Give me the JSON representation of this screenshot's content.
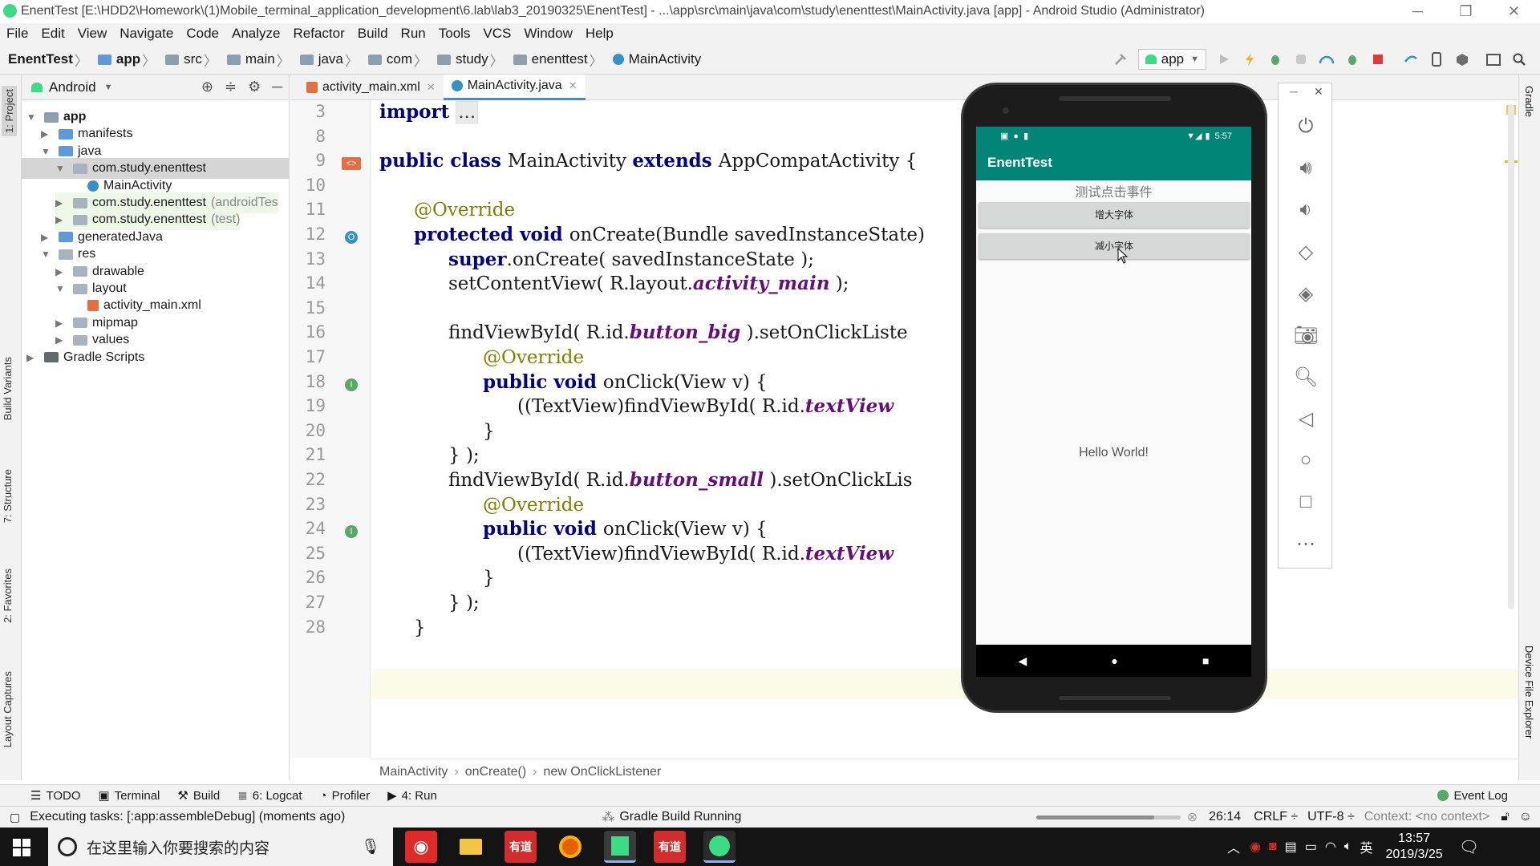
{
  "window": {
    "title": "EnentTest [E:\\HDD2\\Homework\\(1)Mobile_terminal_application_development\\6.lab\\lab3_20190325\\EnentTest] - ...\\app\\src\\main\\java\\com\\study\\enenttest\\MainActivity.java [app] - Android Studio (Administrator)"
  },
  "menu": [
    "File",
    "Edit",
    "View",
    "Navigate",
    "Code",
    "Analyze",
    "Refactor",
    "Build",
    "Run",
    "Tools",
    "VCS",
    "Window",
    "Help"
  ],
  "breadcrumb": [
    "EnentTest",
    "app",
    "src",
    "main",
    "java",
    "com",
    "study",
    "enenttest",
    "MainActivity"
  ],
  "run_config": "app",
  "left_tabs": [
    "1: Project",
    "Build Variants",
    "7: Structure",
    "2: Favorites",
    "Layout Captures"
  ],
  "right_tabs": [
    "Gradle",
    "Device File Explorer"
  ],
  "project": {
    "view": "Android",
    "tree": [
      {
        "label": "app",
        "indent": 0,
        "arrow": "▼",
        "bold": true
      },
      {
        "label": "manifests",
        "indent": 1,
        "arrow": "▶"
      },
      {
        "label": "java",
        "indent": 1,
        "arrow": "▼"
      },
      {
        "label": "com.study.enenttest",
        "indent": 2,
        "arrow": "▼",
        "selected": true
      },
      {
        "label": "MainActivity",
        "indent": 3,
        "arrow": ""
      },
      {
        "label": "com.study.enenttest",
        "suffix": "(androidTes",
        "indent": 2,
        "arrow": "▶",
        "hl": true
      },
      {
        "label": "com.study.enenttest",
        "suffix": "(test)",
        "indent": 2,
        "arrow": "▶",
        "hl": true
      },
      {
        "label": "generatedJava",
        "indent": 1,
        "arrow": "▶"
      },
      {
        "label": "res",
        "indent": 1,
        "arrow": "▼"
      },
      {
        "label": "drawable",
        "indent": 2,
        "arrow": "▶"
      },
      {
        "label": "layout",
        "indent": 2,
        "arrow": "▼"
      },
      {
        "label": "activity_main.xml",
        "indent": 3,
        "arrow": ""
      },
      {
        "label": "mipmap",
        "indent": 2,
        "arrow": "▶"
      },
      {
        "label": "values",
        "indent": 2,
        "arrow": "▶"
      },
      {
        "label": "Gradle Scripts",
        "indent": 0,
        "arrow": "▶"
      }
    ]
  },
  "editor": {
    "tabs": [
      {
        "label": "activity_main.xml",
        "active": false
      },
      {
        "label": "MainActivity.java",
        "active": true
      }
    ],
    "line_numbers": [
      "3",
      "8",
      "9",
      "10",
      "11",
      "12",
      "13",
      "14",
      "15",
      "16",
      "17",
      "18",
      "19",
      "20",
      "21",
      "22",
      "23",
      "24",
      "25",
      "26",
      "27",
      "28"
    ],
    "lines": [
      {
        "indent": 0,
        "parts": [
          [
            "kw",
            "import "
          ],
          [
            "fold",
            "..."
          ]
        ]
      },
      {
        "indent": 0,
        "parts": []
      },
      {
        "indent": 0,
        "parts": [
          [
            "kw",
            "public class "
          ],
          [
            "",
            "MainActivity "
          ],
          [
            "kw",
            "extends "
          ],
          [
            "",
            "AppCompatActivity {"
          ]
        ]
      },
      {
        "indent": 0,
        "parts": []
      },
      {
        "indent": 1,
        "parts": [
          [
            "an",
            "@Override"
          ]
        ]
      },
      {
        "indent": 1,
        "parts": [
          [
            "kw",
            "protected void "
          ],
          [
            "",
            "onCreate(Bundle savedInstanceState)"
          ]
        ]
      },
      {
        "indent": 2,
        "parts": [
          [
            "kw",
            "super"
          ],
          [
            "",
            ".onCreate( savedInstanceState );"
          ]
        ]
      },
      {
        "indent": 2,
        "parts": [
          [
            "",
            "setContentView( R.layout."
          ],
          [
            "it",
            "activity_main"
          ],
          [
            "",
            " );"
          ]
        ]
      },
      {
        "indent": 0,
        "parts": []
      },
      {
        "indent": 2,
        "parts": [
          [
            "",
            "findViewById( R.id."
          ],
          [
            "it",
            "button_big"
          ],
          [
            "",
            " ).setOnClickListe"
          ]
        ]
      },
      {
        "indent": 3,
        "parts": [
          [
            "an",
            "@Override"
          ]
        ]
      },
      {
        "indent": 3,
        "parts": [
          [
            "kw",
            "public void "
          ],
          [
            "",
            "onClick(View v) {"
          ]
        ]
      },
      {
        "indent": 4,
        "parts": [
          [
            "",
            "((TextView)findViewById( R.id."
          ],
          [
            "it",
            "textView"
          ]
        ]
      },
      {
        "indent": 3,
        "parts": [
          [
            "",
            "}"
          ]
        ]
      },
      {
        "indent": 2,
        "parts": [
          [
            "",
            "} );"
          ]
        ]
      },
      {
        "indent": 2,
        "parts": [
          [
            "",
            "findViewById( R.id."
          ],
          [
            "it",
            "button_small"
          ],
          [
            "",
            " ).setOnClickLis"
          ]
        ]
      },
      {
        "indent": 3,
        "parts": [
          [
            "an",
            "@Override"
          ]
        ]
      },
      {
        "indent": 3,
        "parts": [
          [
            "kw",
            "public void "
          ],
          [
            "",
            "onClick(View v) {"
          ]
        ]
      },
      {
        "indent": 4,
        "parts": [
          [
            "",
            "((TextView)findViewById( R.id."
          ],
          [
            "it",
            "textView"
          ]
        ]
      },
      {
        "indent": 3,
        "parts": [
          [
            "",
            "}"
          ]
        ]
      },
      {
        "indent": 2,
        "parts": [
          [
            "",
            "} );"
          ]
        ]
      },
      {
        "indent": 1,
        "parts": [
          [
            "",
            "}"
          ]
        ]
      }
    ],
    "breadcrumb": [
      "MainActivity",
      "onCreate()",
      "new OnClickListener"
    ]
  },
  "bottom_tabs": [
    "TODO",
    "Terminal",
    "Build",
    "6: Logcat",
    "Profiler",
    "4: Run"
  ],
  "event_log": "Event Log",
  "status": {
    "message": "Executing tasks: [:app:assembleDebug] (moments ago)",
    "task": "Gradle Build Running",
    "position": "26:14",
    "line_sep": "CRLF ÷",
    "encoding": "UTF-8 ÷",
    "context": "Context: <no context>"
  },
  "emulator": {
    "time": "5:57",
    "app_title": "EnentTest",
    "label": "测试点击事件",
    "button_big": "增大字体",
    "button_small": "减小字体",
    "hello": "Hello World!"
  },
  "taskbar": {
    "search_placeholder": "在这里输入你要搜索的内容",
    "ime": "英",
    "time": "13:57",
    "date": "2019/3/25"
  },
  "colors": {
    "accent": "#4a88c7",
    "app_bar": "#008577",
    "keyword": "#000080",
    "annotation": "#808000",
    "field": "#660e7a"
  }
}
